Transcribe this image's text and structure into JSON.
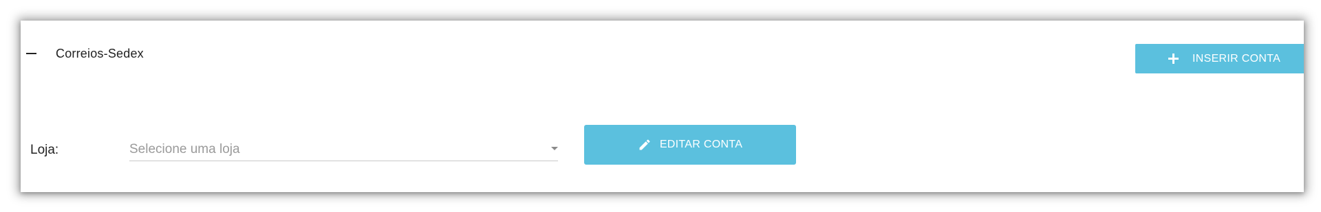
{
  "panel": {
    "title": "Correios-Sedex",
    "collapse_icon": "minus-icon"
  },
  "actions": {
    "insert_label": "INSERIR CONTA",
    "insert_icon": "plus-icon",
    "edit_label": "EDITAR CONTA",
    "edit_icon": "pencil-icon"
  },
  "form": {
    "store_label": "Loja:",
    "store_placeholder": "Selecione uma loja",
    "store_value": "",
    "caret_icon": "caret-down-icon"
  },
  "colors": {
    "accent": "#5bc0de",
    "text": "#222222",
    "placeholder": "#9a9a9a"
  }
}
